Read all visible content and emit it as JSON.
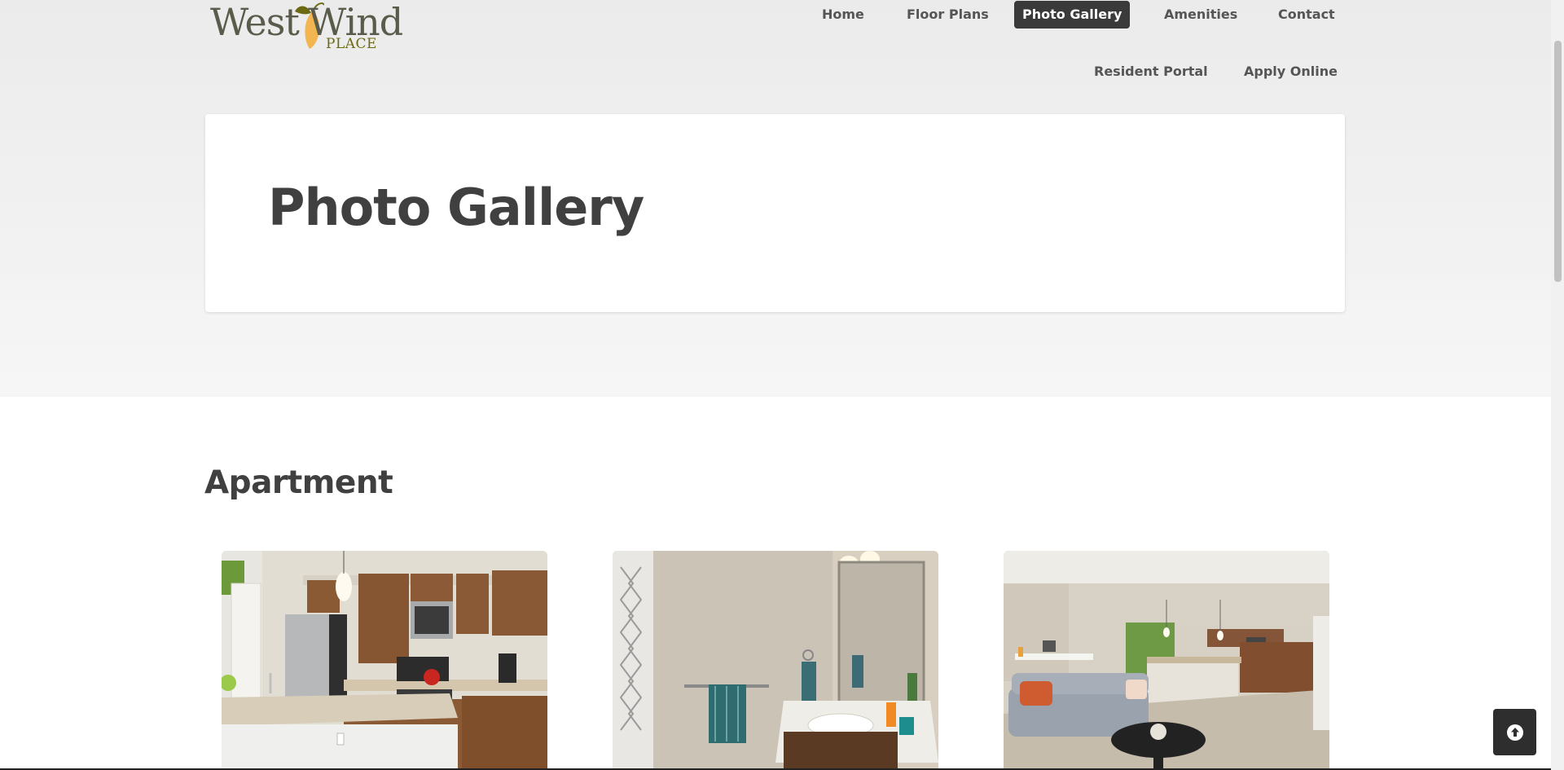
{
  "logo": {
    "text_west": "West",
    "text_wind": "Wind",
    "text_place": "PLACE"
  },
  "nav": {
    "primary": [
      "Home",
      "Floor Plans",
      "Photo Gallery",
      "Amenities",
      "Contact"
    ],
    "active": "Photo Gallery",
    "secondary": [
      "Resident Portal",
      "Apply Online"
    ]
  },
  "page": {
    "title": "Photo Gallery"
  },
  "gallery": {
    "section_title": "Apartment",
    "photos": [
      {
        "subject": "kitchen"
      },
      {
        "subject": "bathroom"
      },
      {
        "subject": "living-room"
      }
    ]
  },
  "controls": {
    "back_to_top_icon": "arrow-up-circle-icon"
  },
  "colors": {
    "nav_active_bg": "#3a3a3a",
    "text": "#404040",
    "logo_green": "#6b6a12",
    "logo_orange": "#f0b24a"
  }
}
